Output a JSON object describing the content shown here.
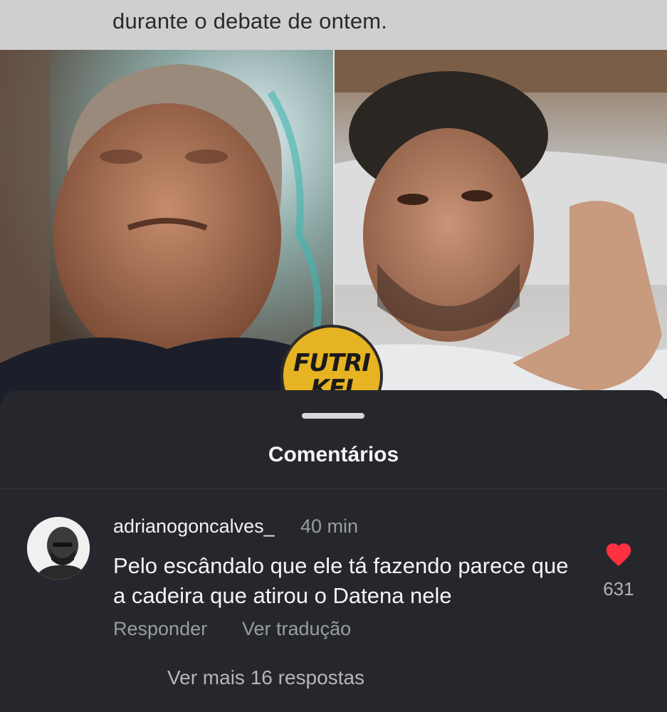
{
  "post": {
    "caption_fragment": "durante o debate de ontem.",
    "logo": {
      "line1": "FUTRI",
      "line2": "KEI"
    }
  },
  "comments_sheet": {
    "title": "Comentários",
    "comment": {
      "username": "adrianogoncalves_",
      "time": "40 min",
      "text": "Pelo escândalo que ele tá fazendo parece que a cadeira que atirou o Datena nele",
      "reply_label": "Responder",
      "translate_label": "Ver tradução",
      "like_count": "631",
      "like_icon": "heart-icon",
      "like_color": "#ff3040"
    },
    "more_replies_label": "Ver mais 16 respostas"
  }
}
